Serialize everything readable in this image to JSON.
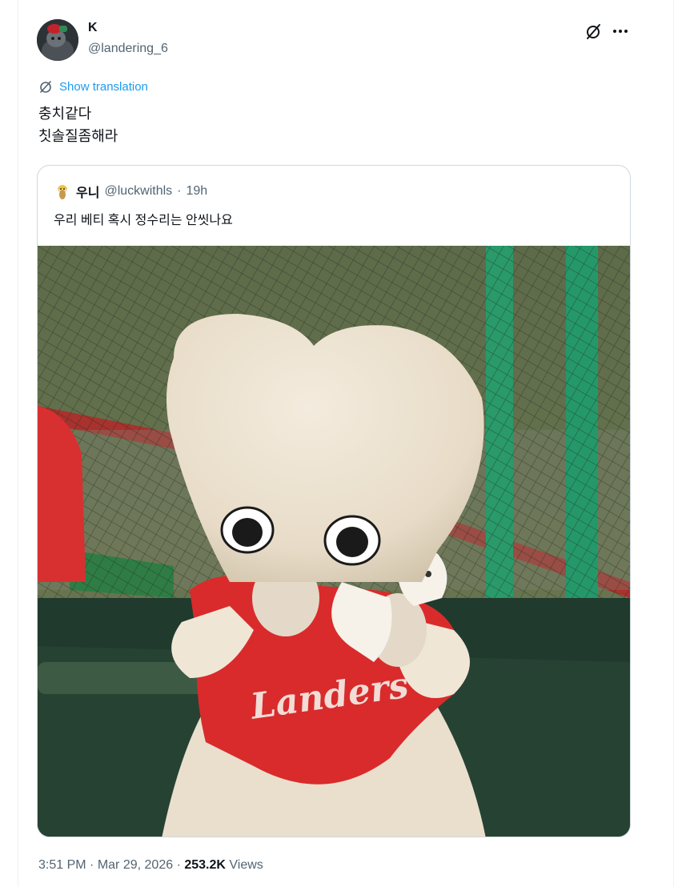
{
  "author": {
    "name": "K",
    "handle": "@landering_6"
  },
  "actions": {
    "grok_icon": "slashed-circle-icon",
    "more_icon": "more-horizontal-icon"
  },
  "translation": {
    "label": "Show translation",
    "icon": "globe-slash-icon"
  },
  "tweet": {
    "lines": [
      "충치같다",
      "칫솔질좀해라"
    ]
  },
  "quote": {
    "name": "우니",
    "handle": "@luckwithls",
    "separator": "·",
    "time": "19h",
    "text": "우리 베티 혹시 정수리는 안씻나요",
    "media_description_icon": "photo"
  },
  "meta": {
    "time": "3:51 PM",
    "dot1": "·",
    "date": "Mar 29, 2026",
    "dot2": "·",
    "views_count": "253.2K",
    "views_label": "Views"
  },
  "colors": {
    "accent": "#1d9bf0",
    "text_primary": "#0f1419",
    "text_secondary": "#536471",
    "border": "#cfd9de"
  }
}
